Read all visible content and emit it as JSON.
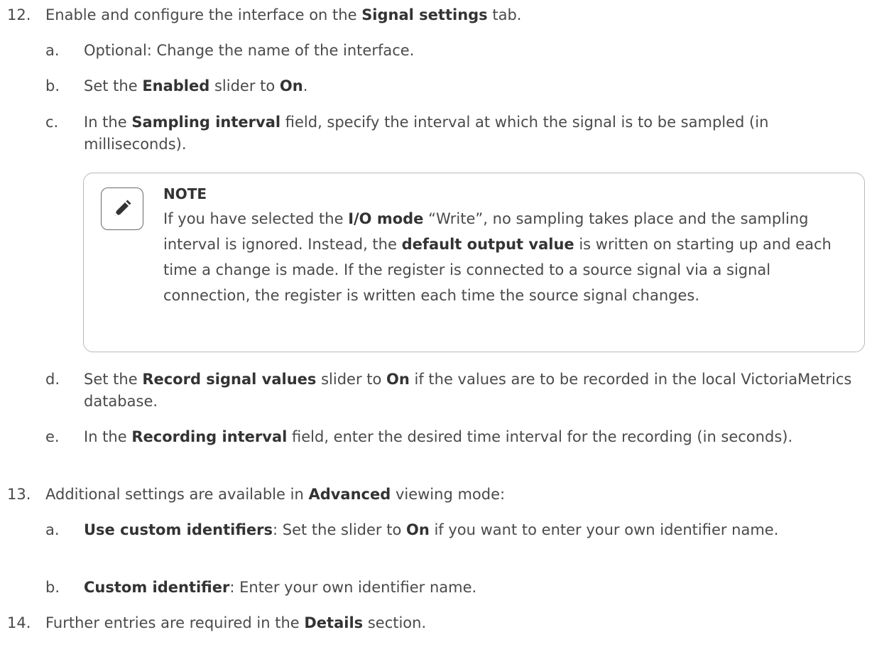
{
  "steps": [
    {
      "number": "12.",
      "parts": [
        "Enable and configure the interface on the ",
        "Signal settings",
        " tab."
      ],
      "subs": [
        {
          "letter": "a.",
          "parts": [
            "Optional: Change the name of the interface."
          ]
        },
        {
          "letter": "b.",
          "parts": [
            "Set the ",
            "Enabled",
            " slider to ",
            "On",
            "."
          ]
        },
        {
          "letter": "c.",
          "parts": [
            "In the ",
            "Sampling interval",
            " field, specify the interval at which the signal is to be sampled (in milliseconds)."
          ]
        },
        {
          "letter": "d.",
          "parts": [
            "Set the ",
            "Record signal values",
            " slider to ",
            "On",
            " if the values are to be recorded in the local VictoriaMetrics database."
          ]
        },
        {
          "letter": "e.",
          "parts": [
            "In the ",
            "Recording interval",
            " field, enter the desired time interval for the recording (in seconds)."
          ]
        }
      ]
    },
    {
      "number": "13.",
      "parts": [
        "Additional settings are available in ",
        "Advanced",
        " viewing mode:"
      ],
      "subs": [
        {
          "letter": "a.",
          "parts": [
            "Use custom identifiers",
            ": Set the slider to ",
            "On",
            " if you want to enter your own identifier name."
          ]
        },
        {
          "letter": "b.",
          "parts": [
            "Custom identifier",
            ": Enter your own identifier name."
          ]
        }
      ]
    },
    {
      "number": "14.",
      "parts": [
        "Further entries are required in the ",
        "Details",
        " section."
      ],
      "subs": []
    }
  ],
  "note": {
    "title": "NOTE",
    "icon": "pencil-icon",
    "parts": [
      "If you have selected the ",
      "I/O mode",
      " “Write”, no sampling takes place and the sampling interval is ignored. Instead, the ",
      "default output value",
      " is written on starting up and each time a change is made. If the register is connected to a source signal via a signal connection, the register is written each time the source signal changes."
    ]
  }
}
